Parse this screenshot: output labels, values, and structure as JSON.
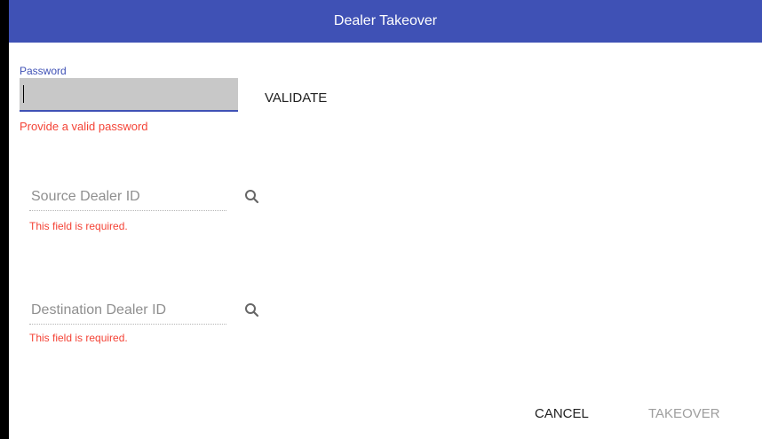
{
  "dialog": {
    "title": "Dealer Takeover",
    "colors": {
      "header": "#3f51b5",
      "error": "#f44336",
      "disabled": "#9e9e9e"
    }
  },
  "password": {
    "label": "Password",
    "value": "",
    "error": "Provide a valid password",
    "validate_label": "VALIDATE"
  },
  "source_dealer": {
    "placeholder": "Source Dealer ID",
    "value": "",
    "error": "This field is required.",
    "icon": "search-icon"
  },
  "destination_dealer": {
    "placeholder": "Destination Dealer ID",
    "value": "",
    "error": "This field is required.",
    "icon": "search-icon"
  },
  "actions": {
    "cancel_label": "CANCEL",
    "takeover_label": "TAKEOVER",
    "takeover_disabled": true
  }
}
